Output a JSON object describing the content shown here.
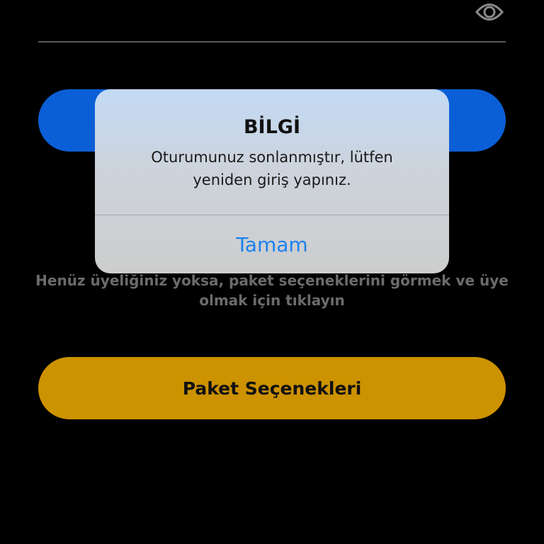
{
  "form": {
    "password_visibility_icon": "eye-icon",
    "login_button_color": "#0a5fd6"
  },
  "signup": {
    "hint_text": "Henüz üyeliğiniz yoksa, paket seçeneklerini görmek ve üye olmak için tıklayın",
    "package_button_label": "Paket Seçenekleri",
    "package_button_color": "#cc9200"
  },
  "alert": {
    "title": "BİLGİ",
    "message": "Oturumunuz sonlanmıştır, lütfen yeniden giriş yapınız.",
    "action_label": "Tamam",
    "action_color": "#1a82f0"
  }
}
